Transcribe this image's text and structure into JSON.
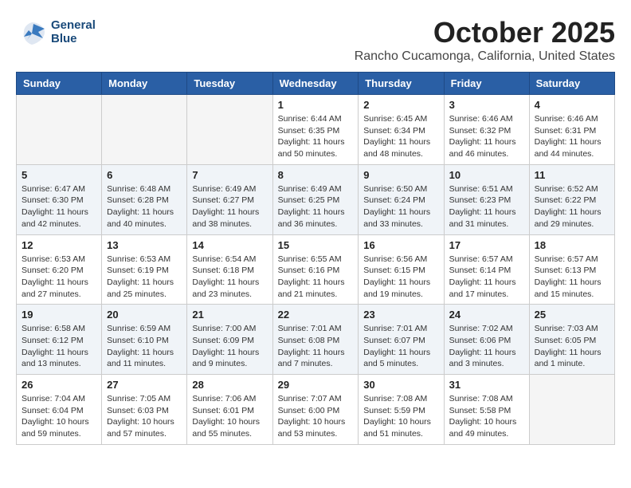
{
  "header": {
    "logo_line1": "General",
    "logo_line2": "Blue",
    "month": "October 2025",
    "location": "Rancho Cucamonga, California, United States"
  },
  "weekdays": [
    "Sunday",
    "Monday",
    "Tuesday",
    "Wednesday",
    "Thursday",
    "Friday",
    "Saturday"
  ],
  "weeks": [
    [
      {
        "day": "",
        "info": ""
      },
      {
        "day": "",
        "info": ""
      },
      {
        "day": "",
        "info": ""
      },
      {
        "day": "1",
        "info": "Sunrise: 6:44 AM\nSunset: 6:35 PM\nDaylight: 11 hours\nand 50 minutes."
      },
      {
        "day": "2",
        "info": "Sunrise: 6:45 AM\nSunset: 6:34 PM\nDaylight: 11 hours\nand 48 minutes."
      },
      {
        "day": "3",
        "info": "Sunrise: 6:46 AM\nSunset: 6:32 PM\nDaylight: 11 hours\nand 46 minutes."
      },
      {
        "day": "4",
        "info": "Sunrise: 6:46 AM\nSunset: 6:31 PM\nDaylight: 11 hours\nand 44 minutes."
      }
    ],
    [
      {
        "day": "5",
        "info": "Sunrise: 6:47 AM\nSunset: 6:30 PM\nDaylight: 11 hours\nand 42 minutes."
      },
      {
        "day": "6",
        "info": "Sunrise: 6:48 AM\nSunset: 6:28 PM\nDaylight: 11 hours\nand 40 minutes."
      },
      {
        "day": "7",
        "info": "Sunrise: 6:49 AM\nSunset: 6:27 PM\nDaylight: 11 hours\nand 38 minutes."
      },
      {
        "day": "8",
        "info": "Sunrise: 6:49 AM\nSunset: 6:25 PM\nDaylight: 11 hours\nand 36 minutes."
      },
      {
        "day": "9",
        "info": "Sunrise: 6:50 AM\nSunset: 6:24 PM\nDaylight: 11 hours\nand 33 minutes."
      },
      {
        "day": "10",
        "info": "Sunrise: 6:51 AM\nSunset: 6:23 PM\nDaylight: 11 hours\nand 31 minutes."
      },
      {
        "day": "11",
        "info": "Sunrise: 6:52 AM\nSunset: 6:22 PM\nDaylight: 11 hours\nand 29 minutes."
      }
    ],
    [
      {
        "day": "12",
        "info": "Sunrise: 6:53 AM\nSunset: 6:20 PM\nDaylight: 11 hours\nand 27 minutes."
      },
      {
        "day": "13",
        "info": "Sunrise: 6:53 AM\nSunset: 6:19 PM\nDaylight: 11 hours\nand 25 minutes."
      },
      {
        "day": "14",
        "info": "Sunrise: 6:54 AM\nSunset: 6:18 PM\nDaylight: 11 hours\nand 23 minutes."
      },
      {
        "day": "15",
        "info": "Sunrise: 6:55 AM\nSunset: 6:16 PM\nDaylight: 11 hours\nand 21 minutes."
      },
      {
        "day": "16",
        "info": "Sunrise: 6:56 AM\nSunset: 6:15 PM\nDaylight: 11 hours\nand 19 minutes."
      },
      {
        "day": "17",
        "info": "Sunrise: 6:57 AM\nSunset: 6:14 PM\nDaylight: 11 hours\nand 17 minutes."
      },
      {
        "day": "18",
        "info": "Sunrise: 6:57 AM\nSunset: 6:13 PM\nDaylight: 11 hours\nand 15 minutes."
      }
    ],
    [
      {
        "day": "19",
        "info": "Sunrise: 6:58 AM\nSunset: 6:12 PM\nDaylight: 11 hours\nand 13 minutes."
      },
      {
        "day": "20",
        "info": "Sunrise: 6:59 AM\nSunset: 6:10 PM\nDaylight: 11 hours\nand 11 minutes."
      },
      {
        "day": "21",
        "info": "Sunrise: 7:00 AM\nSunset: 6:09 PM\nDaylight: 11 hours\nand 9 minutes."
      },
      {
        "day": "22",
        "info": "Sunrise: 7:01 AM\nSunset: 6:08 PM\nDaylight: 11 hours\nand 7 minutes."
      },
      {
        "day": "23",
        "info": "Sunrise: 7:01 AM\nSunset: 6:07 PM\nDaylight: 11 hours\nand 5 minutes."
      },
      {
        "day": "24",
        "info": "Sunrise: 7:02 AM\nSunset: 6:06 PM\nDaylight: 11 hours\nand 3 minutes."
      },
      {
        "day": "25",
        "info": "Sunrise: 7:03 AM\nSunset: 6:05 PM\nDaylight: 11 hours\nand 1 minute."
      }
    ],
    [
      {
        "day": "26",
        "info": "Sunrise: 7:04 AM\nSunset: 6:04 PM\nDaylight: 10 hours\nand 59 minutes."
      },
      {
        "day": "27",
        "info": "Sunrise: 7:05 AM\nSunset: 6:03 PM\nDaylight: 10 hours\nand 57 minutes."
      },
      {
        "day": "28",
        "info": "Sunrise: 7:06 AM\nSunset: 6:01 PM\nDaylight: 10 hours\nand 55 minutes."
      },
      {
        "day": "29",
        "info": "Sunrise: 7:07 AM\nSunset: 6:00 PM\nDaylight: 10 hours\nand 53 minutes."
      },
      {
        "day": "30",
        "info": "Sunrise: 7:08 AM\nSunset: 5:59 PM\nDaylight: 10 hours\nand 51 minutes."
      },
      {
        "day": "31",
        "info": "Sunrise: 7:08 AM\nSunset: 5:58 PM\nDaylight: 10 hours\nand 49 minutes."
      },
      {
        "day": "",
        "info": ""
      }
    ]
  ]
}
